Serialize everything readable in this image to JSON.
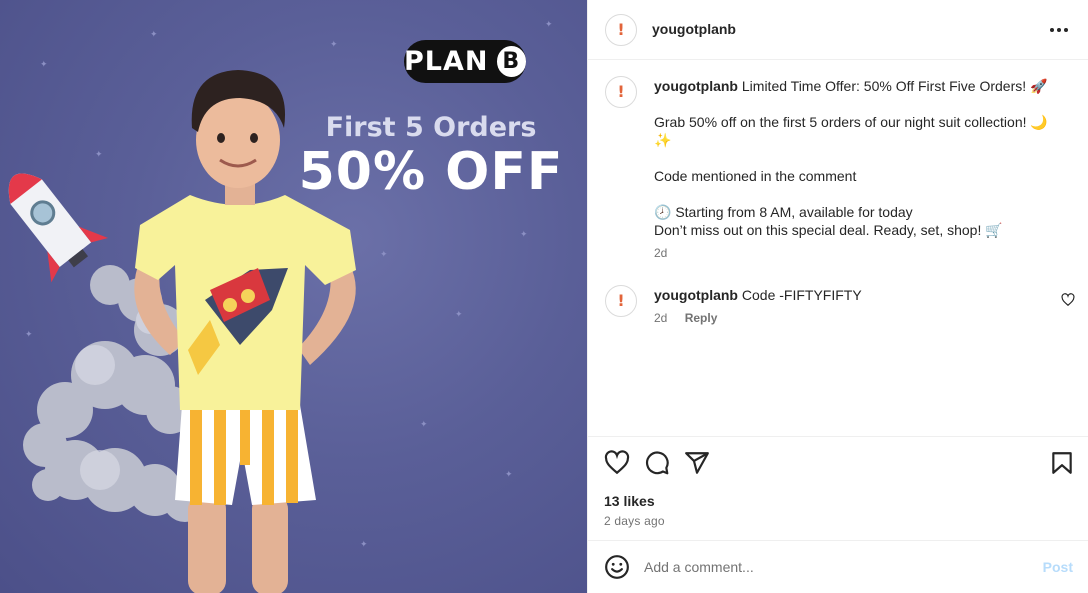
{
  "post_image": {
    "brand_logo": "PLAN",
    "brand_logo_letter": "B",
    "promo_line1": "First 5 Orders",
    "promo_line2": "50% OFF"
  },
  "header": {
    "username": "yougotplanb",
    "more_icon": "more-horizontal-icon"
  },
  "caption": {
    "username": "yougotplanb",
    "title": "Limited Time Offer: 50% Off First Five Orders! 🚀",
    "line1": "Grab 50% off on the first 5 orders of our night suit collection! 🌙 ✨",
    "line2": "Code mentioned in the comment",
    "line3": "🕗 Starting from 8 AM, available for today",
    "line4": "Don’t miss out on this special deal. Ready, set, shop! 🛒",
    "time": "2d"
  },
  "comments": [
    {
      "username": "yougotplanb",
      "text": "Code -FIFTYFIFTY",
      "time": "2d",
      "reply_label": "Reply"
    }
  ],
  "actions": {
    "likes": "13 likes",
    "time_ago": "2 days ago"
  },
  "comment_bar": {
    "placeholder": "Add a comment...",
    "post_label": "Post"
  },
  "colors": {
    "background_purple": "#5a5f98",
    "post_button_disabled": "#b7dcfb",
    "secondary_text": "#737373"
  }
}
